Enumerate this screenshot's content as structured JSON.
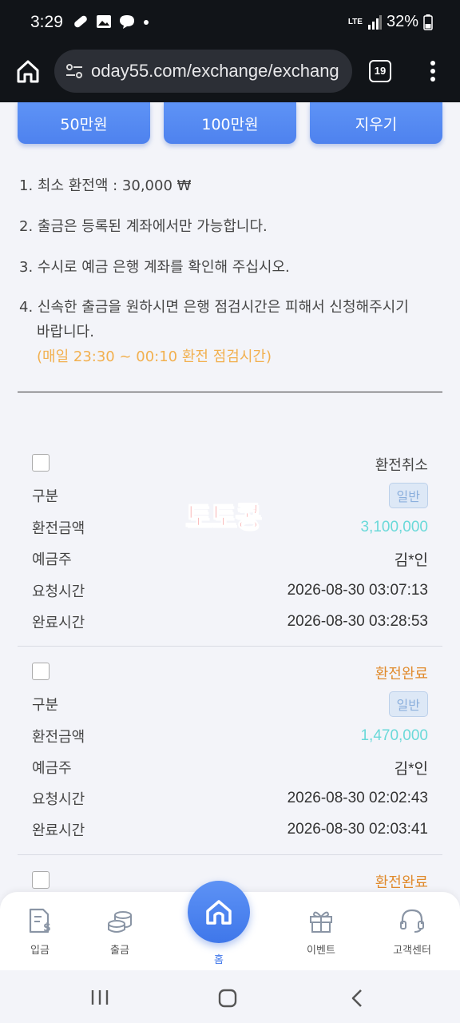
{
  "status_bar": {
    "time": "3:29",
    "network": "LTE",
    "battery": "32%"
  },
  "browser": {
    "url": "oday55.com/exchange/exchang",
    "tab_count": "19"
  },
  "amount_buttons": [
    "50만원",
    "100만원",
    "지우기"
  ],
  "notices": [
    {
      "text": "1. 최소 환전액 : 30,000 ₩"
    },
    {
      "text": "2. 출금은 등록된 계좌에서만 가능합니다."
    },
    {
      "text": "3. 수시로 예금 은행 계좌를 확인해 주십시오."
    },
    {
      "text": "4. 신속한 출금을 원하시면 은행 점검시간은 피해서 신청해주시기",
      "continuation": "바랍니다.",
      "warning": "(매일 23:30 ~ 00:10 환전 점검시간)"
    }
  ],
  "records": [
    {
      "status": "환전취소",
      "labels": {
        "type": "구분",
        "amount": "환전금액",
        "holder": "예금주",
        "requested": "요청시간",
        "completed": "완료시간"
      },
      "type": "일반",
      "amount": "3,100,000",
      "holder": "김*인",
      "requested": "2026-08-30 03:07:13",
      "completed": "2026-08-30 03:28:53"
    },
    {
      "status": "환전완료",
      "labels": {
        "type": "구분",
        "amount": "환전금액",
        "holder": "예금주",
        "requested": "요청시간",
        "completed": "완료시간"
      },
      "type": "일반",
      "amount": "1,470,000",
      "holder": "김*인",
      "requested": "2026-08-30 02:02:43",
      "completed": "2026-08-30 02:03:41"
    },
    {
      "status": "환전완료"
    }
  ],
  "watermark": "토토콩",
  "bottom_nav": {
    "deposit": "입금",
    "withdraw": "출금",
    "home": "홈",
    "event": "이벤트",
    "support": "고객센터"
  },
  "colors": {
    "accent": "#4e82ee",
    "cancel_status": "#444444",
    "complete_status": "#e08a2c",
    "amount": "#6ad9d9",
    "warning": "#f2b04f"
  }
}
